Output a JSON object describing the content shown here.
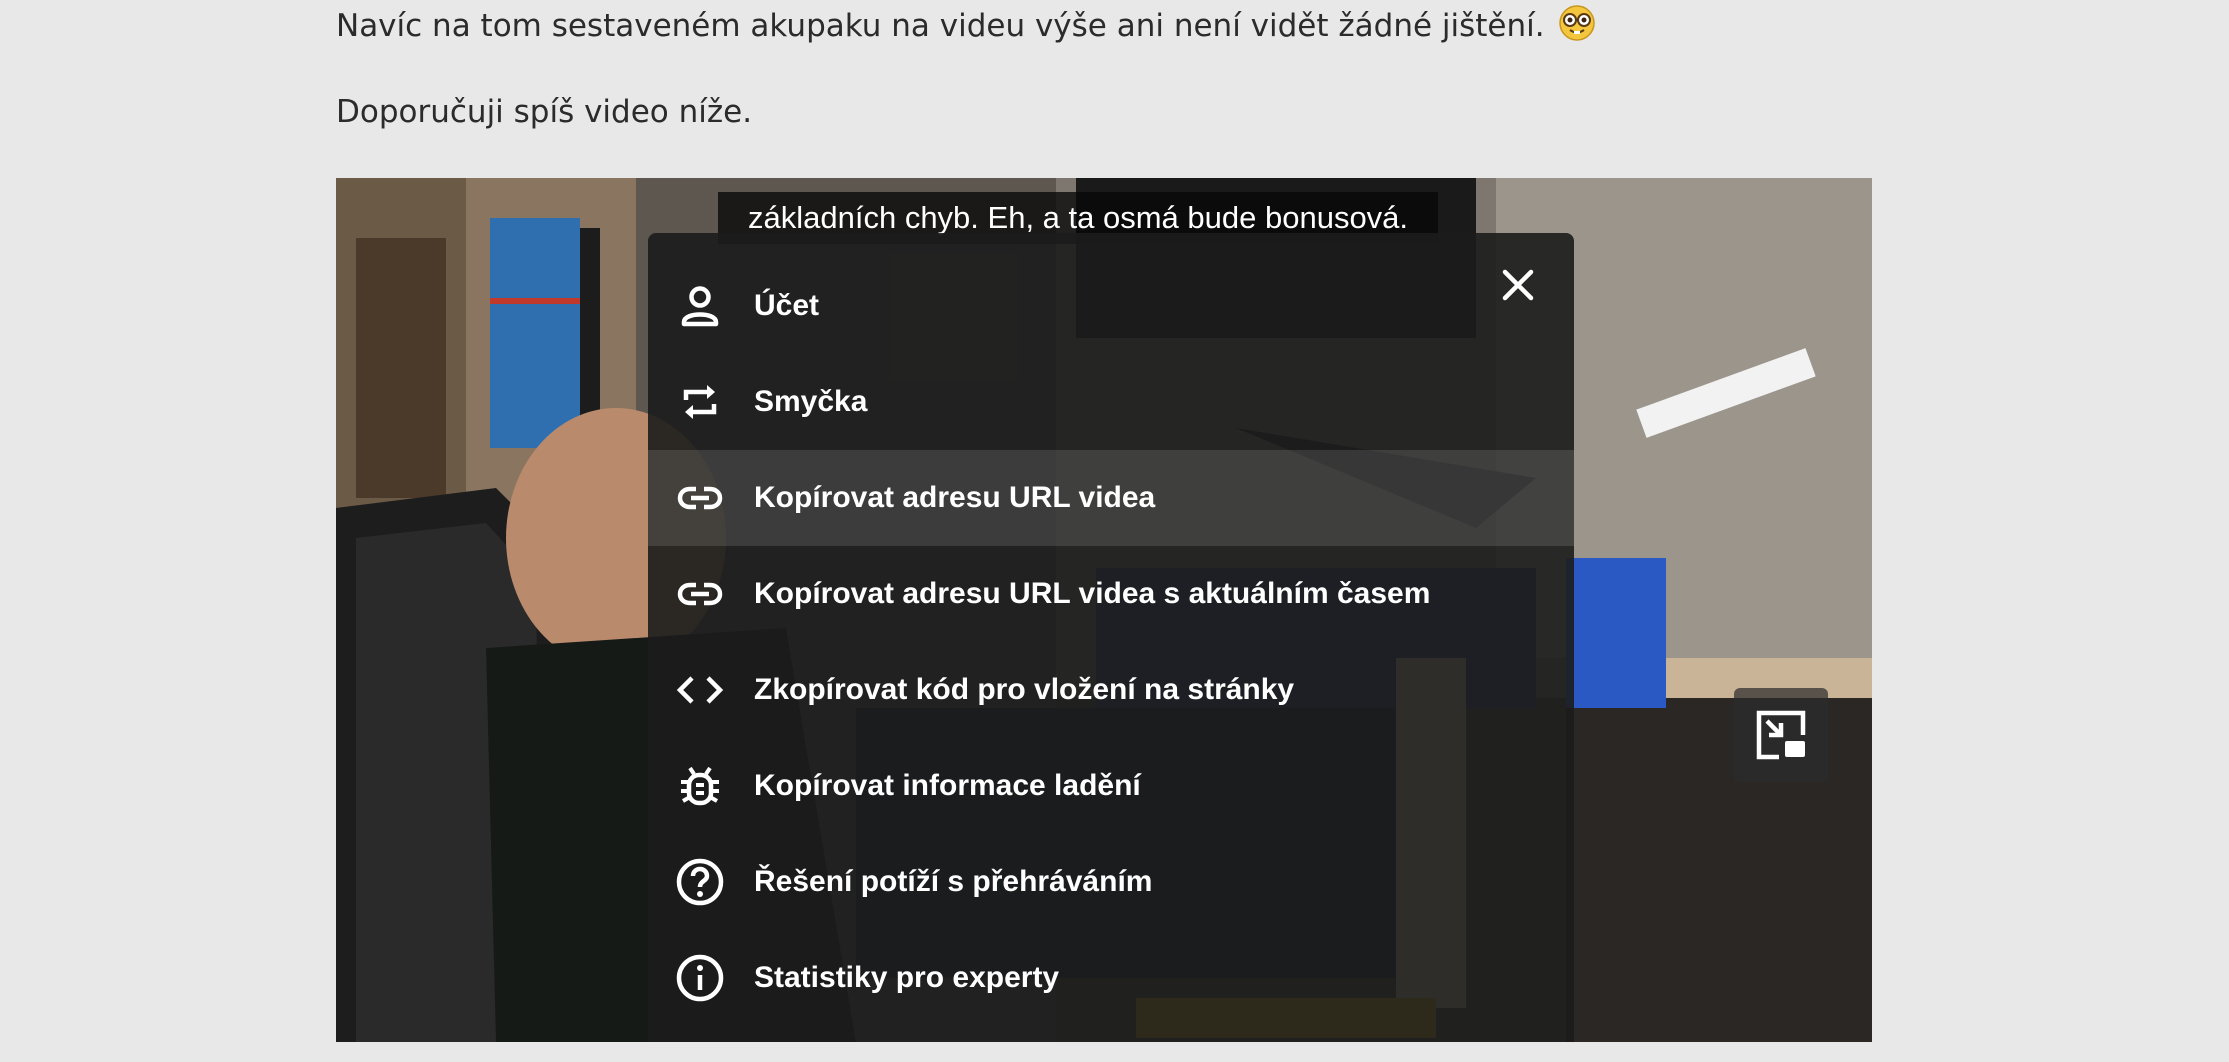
{
  "article": {
    "paragraph1": "Navíc na tom sestaveném akupaku na videu výše ani není vidět žádné jištění.",
    "paragraph2": "Doporučuji spíš video níže.",
    "emoji_icon": "nerd-face-emoji"
  },
  "player": {
    "caption": "základních chyb. Eh, a ta osmá bude bonusová.",
    "menu": {
      "close_icon": "close-icon",
      "items": [
        {
          "label": "Účet",
          "icon": "account-icon"
        },
        {
          "label": "Smyčka",
          "icon": "loop-icon"
        },
        {
          "label": "Kopírovat adresu URL videa",
          "icon": "link-icon",
          "active": true
        },
        {
          "label": "Kopírovat adresu URL videa s aktuálním časem",
          "icon": "link-icon"
        },
        {
          "label": "Zkopírovat kód pro vložení na stránky",
          "icon": "embed-code-icon"
        },
        {
          "label": "Kopírovat informace ladění",
          "icon": "bug-icon"
        },
        {
          "label": "Řešení potíží s přehráváním",
          "icon": "help-circle-icon"
        },
        {
          "label": "Statistiky pro experty",
          "icon": "info-circle-icon"
        }
      ]
    },
    "pip_icon": "miniplayer-icon"
  }
}
